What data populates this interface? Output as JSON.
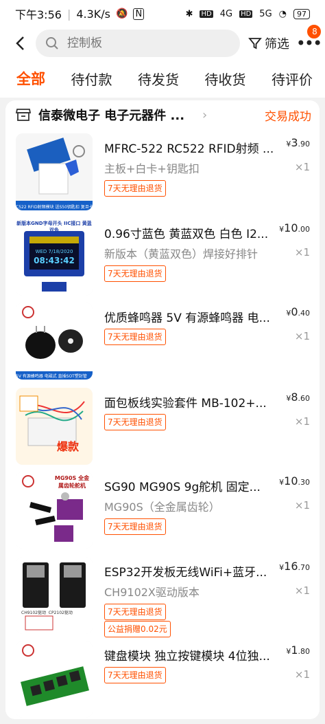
{
  "status_bar": {
    "time": "下午3:56",
    "speed": "4.3K/s",
    "net1": "HD",
    "net2": "4G",
    "net3": "HD",
    "net4": "5G",
    "battery": "97"
  },
  "header": {
    "search_placeholder": "控制板",
    "filter_label": "筛选",
    "more_badge": "8"
  },
  "tabs": [
    {
      "label": "全部",
      "active": true
    },
    {
      "label": "待付款",
      "active": false
    },
    {
      "label": "待发货",
      "active": false
    },
    {
      "label": "待收货",
      "active": false
    },
    {
      "label": "待评价",
      "active": false
    }
  ],
  "order": {
    "shop_name": "信泰微电子 电子元器件 ...",
    "status": "交易成功",
    "items": [
      {
        "title": "MFRC-522 RC522 RFID射频 ...",
        "spec": "主板+白卡+钥匙扣",
        "price_int": "3",
        "price_dec": ".90",
        "qty": "×1",
        "tags": [
          "7天无理由退货"
        ],
        "thumb_text": "C522 RFID射频模块 送S50钥匙扣 复旦卡"
      },
      {
        "title": "0.96寸蓝色 黄蓝双色 白色 I2...",
        "spec": "新版本（黄蓝双色）焊接好排针",
        "price_int": "10",
        "price_dec": ".00",
        "qty": "×1",
        "tags": [
          "7天无理由退货"
        ],
        "thumb_text": "新版本GND字母开头 IIC接口 黄蓝双色",
        "oled_line1": "WED 7/18/2020",
        "oled_line2": "08:43:42"
      },
      {
        "title": "优质蜂鸣器 5V 有源蜂鸣器 电...",
        "spec": "",
        "price_int": "0",
        "price_dec": ".40",
        "qty": "×1",
        "tags": [
          "7天无理由退货"
        ],
        "thumb_text": "5V 有源蜂鸣器 电磁式 直插SOT塑封管"
      },
      {
        "title": "面包板线实验套件 MB-102+...",
        "spec": "",
        "price_int": "8",
        "price_dec": ".60",
        "qty": "×1",
        "tags": [
          "7天无理由退货"
        ],
        "thumb_text": "爆款"
      },
      {
        "title": "SG90 MG90S 9g舵机 固定...",
        "spec": "MG90S（全金属齿轮）",
        "price_int": "10",
        "price_dec": ".30",
        "qty": "×1",
        "tags": [
          "7天无理由退货"
        ],
        "thumb_text": "MG90S 全金属齿轮舵机"
      },
      {
        "title": "ESP32开发板无线WiFi+蓝牙...",
        "spec": "CH9102X驱动版本",
        "price_int": "16",
        "price_dec": ".70",
        "qty": "×1",
        "tags": [
          "7天无理由退货",
          "公益捐赠0.02元"
        ],
        "thumb_text": "CH9102驱动  CP2102驱动"
      },
      {
        "title": "键盘模块 独立按键模块 4位独...",
        "spec": "",
        "price_int": "1",
        "price_dec": ".80",
        "qty": "×1",
        "tags": [
          "7天无理由退货"
        ],
        "thumb_text": ""
      }
    ]
  },
  "colors": {
    "accent": "#ff5000",
    "background": "#f2f2f2"
  }
}
